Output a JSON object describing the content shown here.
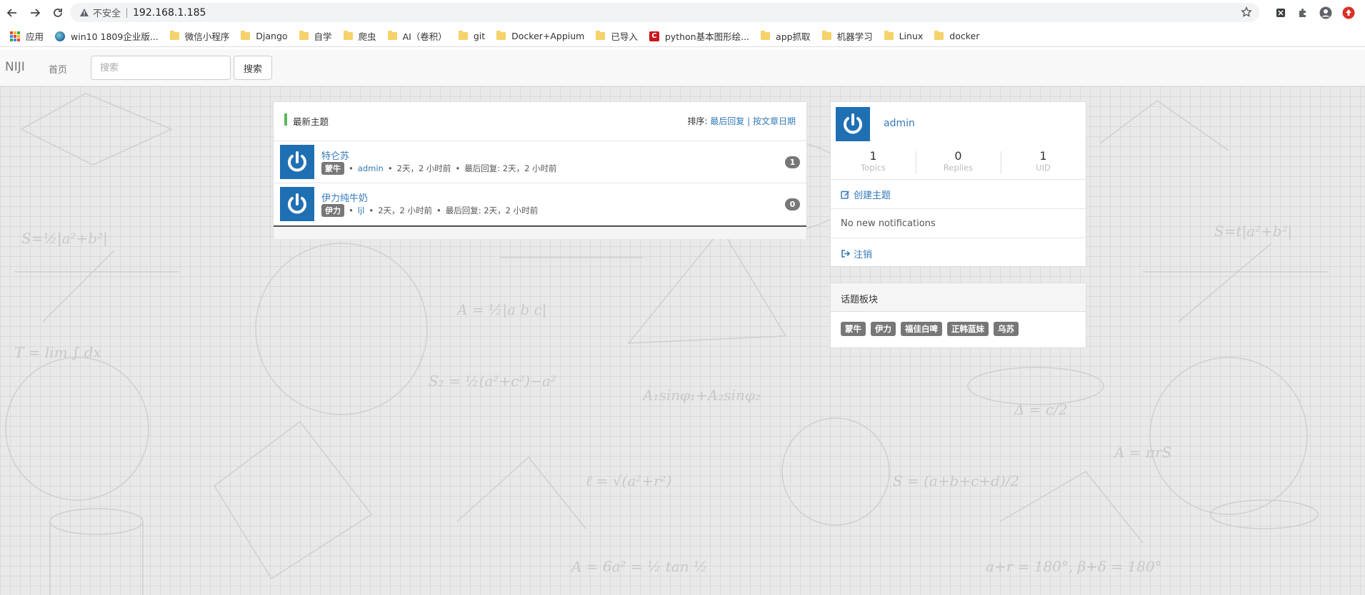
{
  "browser": {
    "insecure_label": "不安全",
    "url": "192.168.1.185",
    "bookmarks": [
      {
        "label": "应用",
        "icon": "apps-grid-icon"
      },
      {
        "label": "win10 1809企业版...",
        "icon": "globe-icon"
      },
      {
        "label": "微信小程序",
        "icon": "folder-icon"
      },
      {
        "label": "Django",
        "icon": "folder-icon"
      },
      {
        "label": "自学",
        "icon": "folder-icon"
      },
      {
        "label": "爬虫",
        "icon": "folder-icon"
      },
      {
        "label": "AI（卷积）",
        "icon": "folder-icon"
      },
      {
        "label": "git",
        "icon": "folder-icon"
      },
      {
        "label": "Docker+Appium",
        "icon": "folder-icon"
      },
      {
        "label": "已导入",
        "icon": "folder-icon"
      },
      {
        "label": "python基本图形绘...",
        "icon": "csdn-icon"
      },
      {
        "label": "app抓取",
        "icon": "folder-icon"
      },
      {
        "label": "机器学习",
        "icon": "folder-icon"
      },
      {
        "label": "Linux",
        "icon": "folder-icon"
      },
      {
        "label": "docker",
        "icon": "folder-icon"
      }
    ]
  },
  "navbar": {
    "brand": "NIJI",
    "home": "首页",
    "search_placeholder": "搜索",
    "search_button": "搜索"
  },
  "topics": {
    "title": "最新主题",
    "sort_prefix": "排序:",
    "sort_last_reply": "最后回复",
    "sort_divider": "|",
    "sort_by_date": "按文章日期",
    "items": [
      {
        "title": "特仑苏",
        "tag": "蒙牛",
        "author": "admin",
        "time": "2天，2 小时前",
        "last_reply": "最后回复: 2天，2 小时前",
        "replies": "1"
      },
      {
        "title": "伊力纯牛奶",
        "tag": "伊力",
        "author": "ljl",
        "time": "2天，2 小时前",
        "last_reply": "最后回复: 2天，2 小时前",
        "replies": "0"
      }
    ]
  },
  "user": {
    "name": "admin",
    "stats": [
      {
        "num": "1",
        "label": "Topics"
      },
      {
        "num": "0",
        "label": "Replies"
      },
      {
        "num": "1",
        "label": "UID"
      }
    ],
    "create_topic": "创建主题",
    "notifications": "No new notifications",
    "logout": "注销"
  },
  "tags_panel": {
    "title": "话题板块",
    "tags": [
      "蒙牛",
      "伊力",
      "福佳白啤",
      "正韩蓝妹",
      "乌苏"
    ]
  },
  "colors": {
    "link": "#337ab7",
    "accent_bar": "#5cb85c",
    "avatar_bg": "#1f6fb3",
    "label_bg": "#777777"
  }
}
